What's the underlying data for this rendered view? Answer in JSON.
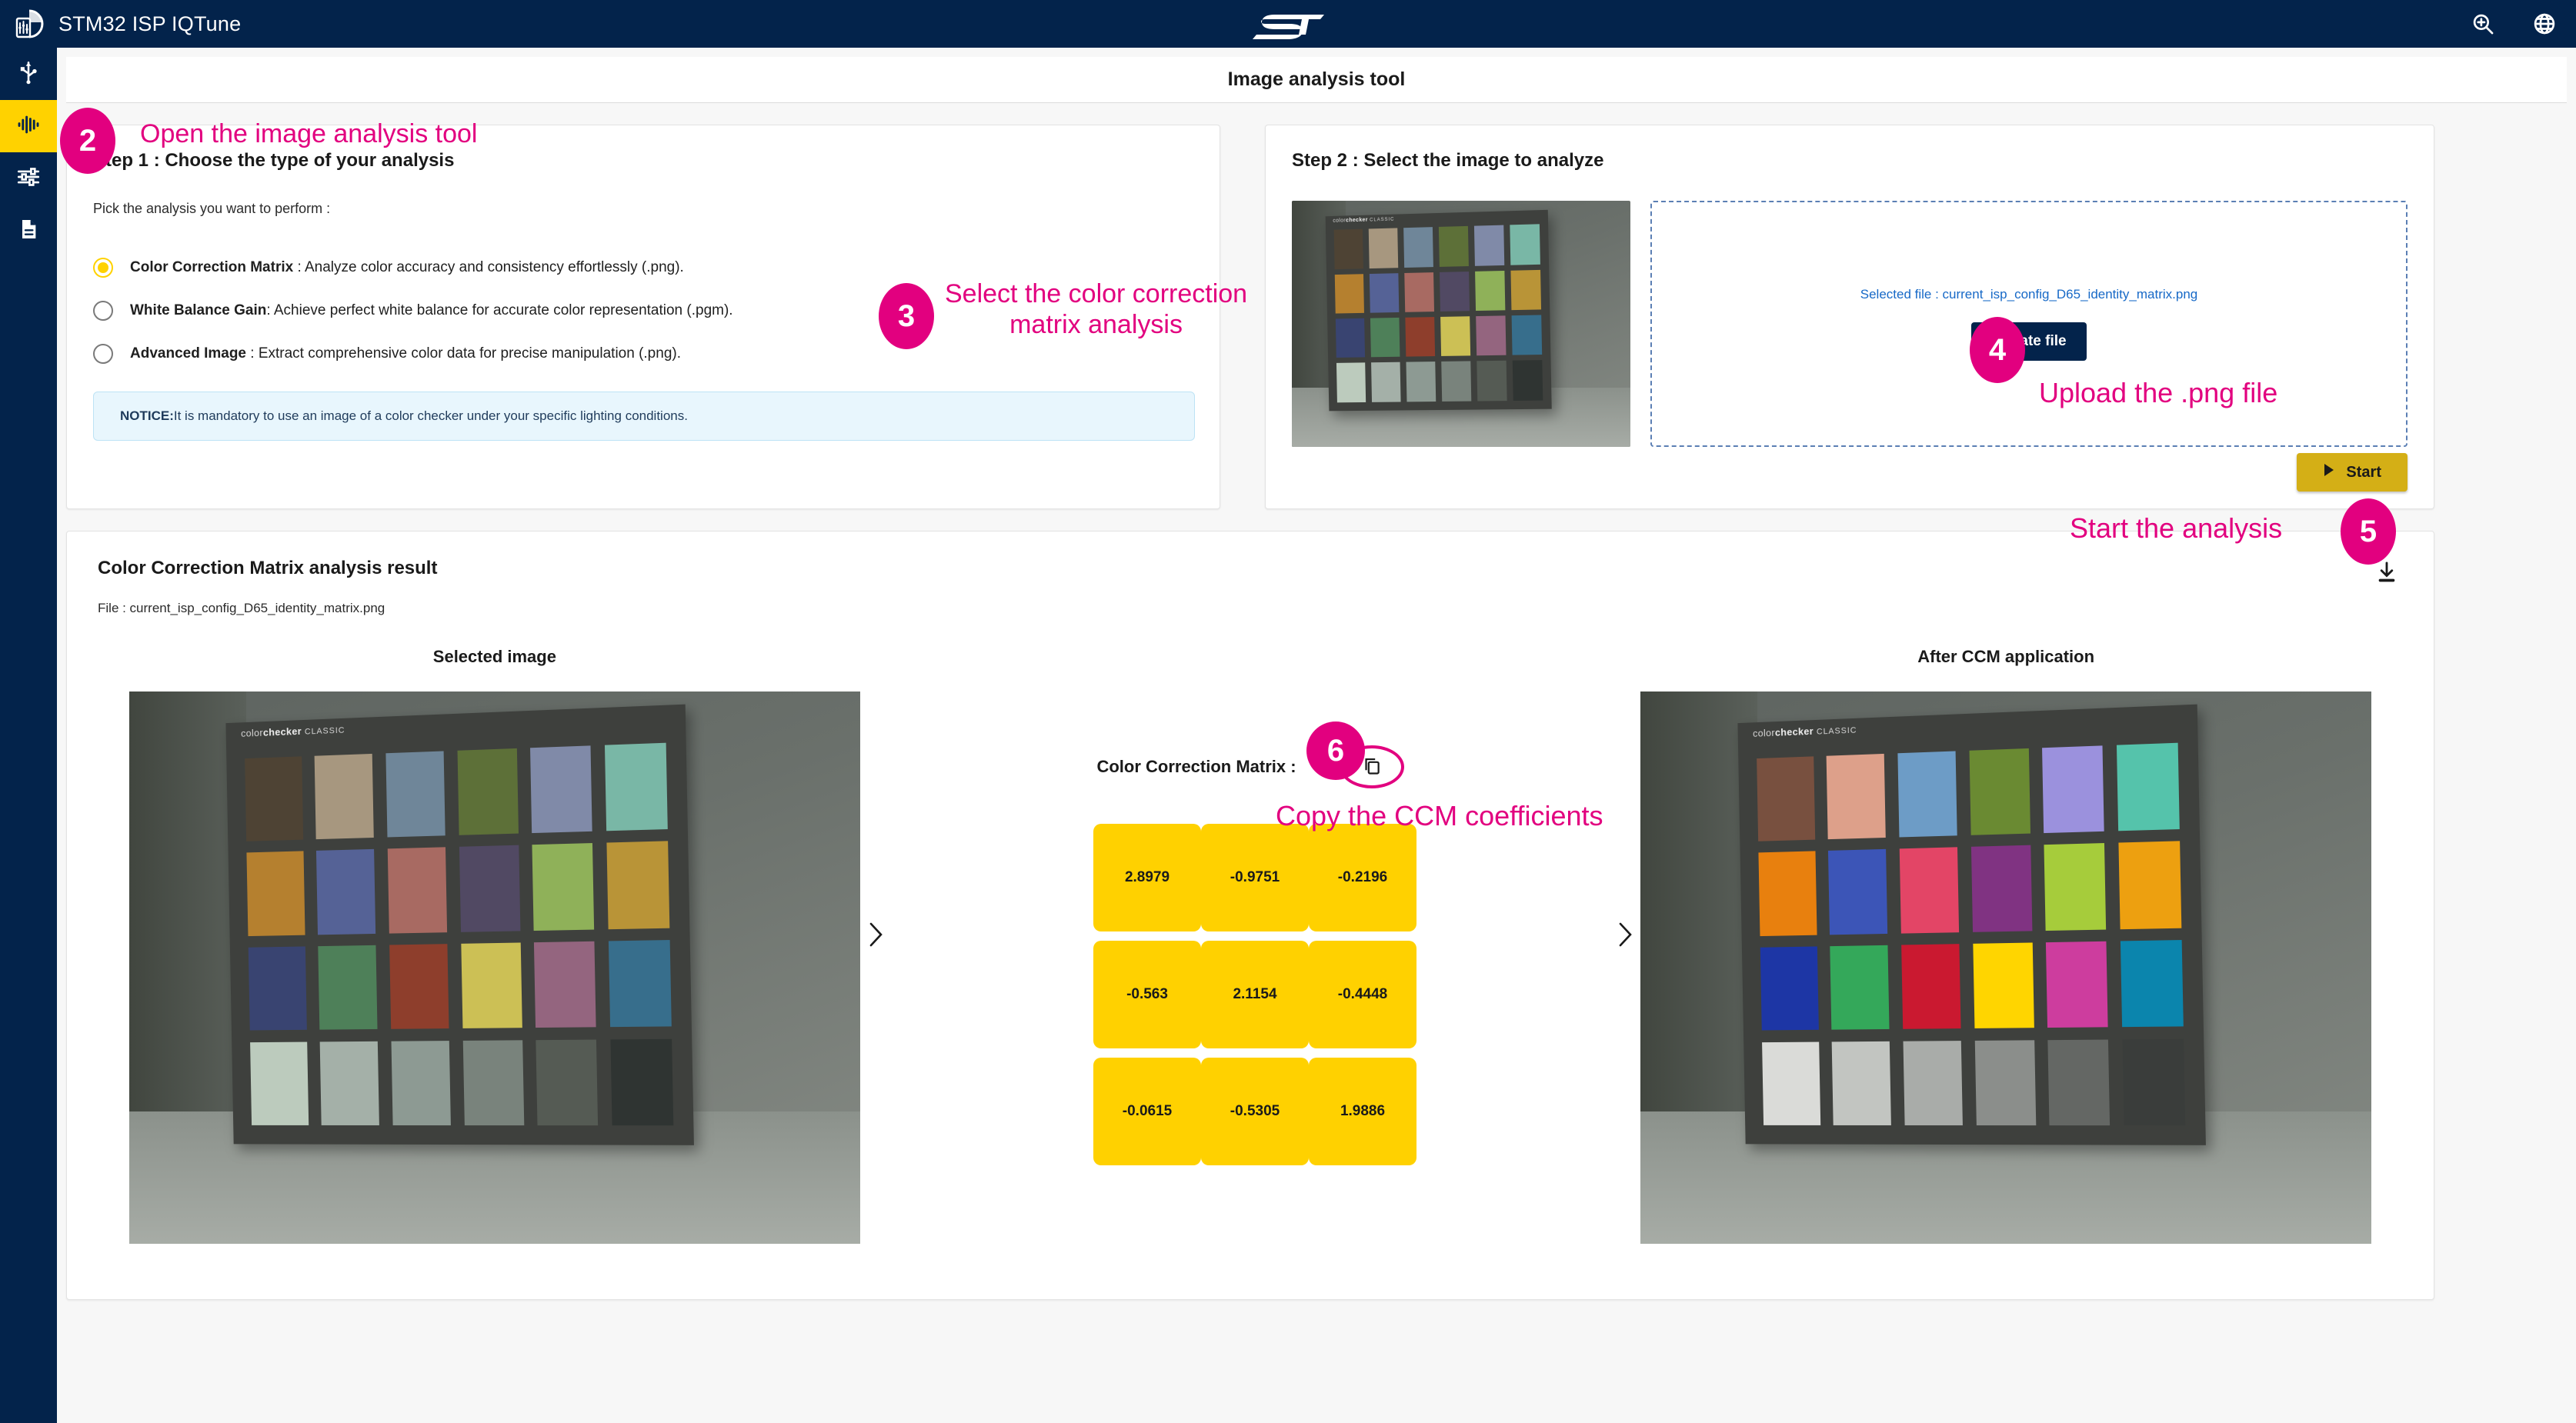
{
  "header": {
    "app_title": "STM32 ISP IQTune",
    "logo_icon": "iqtune-logo-icon",
    "st_logo_icon": "st-logo-icon",
    "actions": [
      {
        "icon": "zoom-in-icon",
        "name": "zoom-in-button"
      },
      {
        "icon": "globe-icon",
        "name": "language-button"
      }
    ]
  },
  "sidebar": {
    "items": [
      {
        "icon": "usb-icon",
        "name": "sidebar-item-usb-connection",
        "active": false
      },
      {
        "icon": "waveform-icon",
        "name": "sidebar-item-image-analysis",
        "active": true
      },
      {
        "icon": "tune-sliders-icon",
        "name": "sidebar-item-tuning",
        "active": false
      },
      {
        "icon": "document-icon",
        "name": "sidebar-item-report",
        "active": false
      }
    ]
  },
  "page": {
    "title": "Image analysis tool"
  },
  "step1": {
    "heading": "Step 1 : Choose the type of your analysis",
    "pick_label": "Pick the analysis you want to perform :",
    "options": [
      {
        "bold": "Color Correction Matrix",
        "rest": " : Analyze color accuracy and consistency effortlessly (.png).",
        "checked": true
      },
      {
        "bold": "White Balance Gain",
        "rest": ": Achieve perfect white balance for accurate color representation (.pgm).",
        "checked": false
      },
      {
        "bold": "Advanced Image",
        "rest": " : Extract comprehensive color data for precise manipulation (.png).",
        "checked": false
      }
    ],
    "notice_label": "NOTICE:",
    "notice_text": " It is mandatory to use an image of a color checker under your specific lighting conditions."
  },
  "step2": {
    "heading": "Step 2 : Select the image to analyze",
    "selected_file": "Selected file : current_isp_config_D65_identity_matrix.png",
    "update_button": "Update file",
    "start_button": "Start",
    "start_icon": "play-triangle-icon"
  },
  "result": {
    "title": "Color Correction Matrix analysis result",
    "file_line": "File : current_isp_config_D65_identity_matrix.png",
    "download_icon": "download-icon",
    "left_pane_label": "Selected image",
    "right_pane_label": "After CCM application",
    "ccm_label": "Color Correction Matrix :",
    "copy_icon": "copy-icon",
    "prev_icon": "chevron-right-icon",
    "next_icon": "chevron-right-icon",
    "matrix": [
      [
        "2.8979",
        "-0.9751",
        "-0.2196"
      ],
      [
        "-0.563",
        "2.1154",
        "-0.4448"
      ],
      [
        "-0.0615",
        "-0.5305",
        "1.9886"
      ]
    ]
  },
  "annotations": [
    {
      "number": "2",
      "text": "Open the image analysis tool"
    },
    {
      "number": "3",
      "text": "Select the color correction\nmatrix analysis"
    },
    {
      "number": "4",
      "text": "Upload the .png file"
    },
    {
      "number": "5",
      "text": "Start the analysis"
    },
    {
      "number": "6",
      "text": "Copy the CCM coefficients"
    }
  ],
  "colors": {
    "brand_navy": "#03234b",
    "accent_yellow": "#ffd200",
    "matrix_yellow": "#ffd100",
    "start_yellow": "#d4af16",
    "annotation_magenta": "#e2007f",
    "link_blue": "#1769c7",
    "notice_blue_bg": "#e8f6fd"
  },
  "color_checker": {
    "title_prefix": "color",
    "title_bold": "checker",
    "title_suffix": "CLASSIC",
    "before_patches": [
      "#4e4334",
      "#a7977f",
      "#6f8699",
      "#5d7038",
      "#808aa8",
      "#79b7a6",
      "#b5802f",
      "#556296",
      "#a86a62",
      "#514963",
      "#8fb159",
      "#b99437",
      "#394471",
      "#4e8059",
      "#8e3e2c",
      "#ccc055",
      "#94657f",
      "#376e8c",
      "#bccbbd",
      "#a4b0a8",
      "#8d9a93",
      "#79837c",
      "#555b54",
      "#2f3432"
    ],
    "after_patches": [
      "#78503f",
      "#dda08a",
      "#6d9cc6",
      "#6a8a32",
      "#9b91dd",
      "#55c3ab",
      "#e8800e",
      "#3c55b7",
      "#e34566",
      "#803382",
      "#a6cc3b",
      "#eda010",
      "#1d36a5",
      "#34a85a",
      "#ca1930",
      "#ffd500",
      "#cd3d9e",
      "#0b85ad",
      "#dadbd8",
      "#c2c5c1",
      "#a9aca9",
      "#8b8e8b",
      "#646764",
      "#3a3d3b"
    ]
  }
}
